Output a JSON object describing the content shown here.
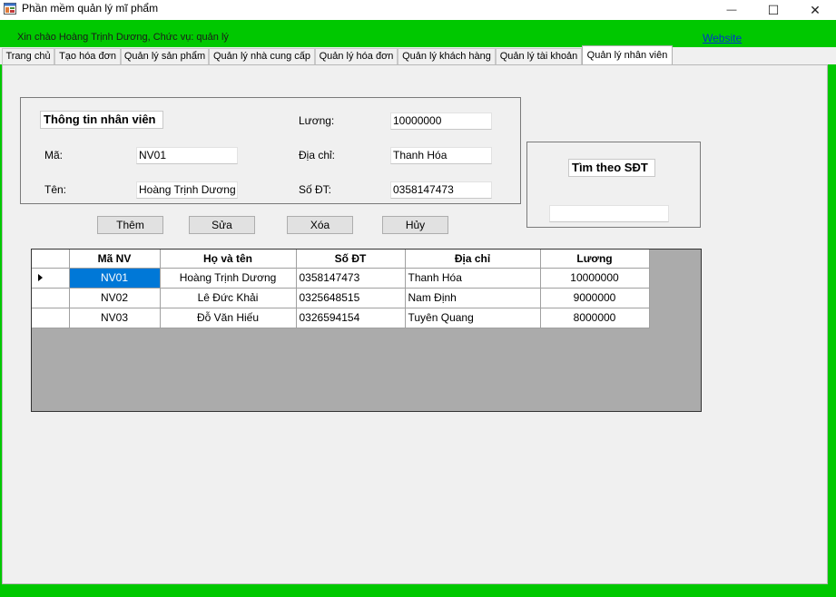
{
  "window": {
    "title": "Phần mềm quản lý mĩ phẩm",
    "minimize_glyph": "—",
    "maximize_glyph": "☐",
    "close_glyph": "✕"
  },
  "header": {
    "greeting": "Xin chào Hoàng Trịnh Dương, Chức vụ: quản lý",
    "website_link": "Website"
  },
  "tabs": [
    {
      "label": "Trang chủ"
    },
    {
      "label": "Tạo hóa đơn"
    },
    {
      "label": "Quản lý sản phẩm"
    },
    {
      "label": "Quản lý nhà cung cấp"
    },
    {
      "label": "Quản lý hóa đơn"
    },
    {
      "label": "Quản lý khách hàng"
    },
    {
      "label": "Quản lý tài khoản"
    },
    {
      "label": "Quản lý nhân viên",
      "active": true
    }
  ],
  "employee_info": {
    "title": "Thông tin nhân viên",
    "ma_label": "Mã:",
    "ma_value": "NV01",
    "ten_label": "Tên:",
    "ten_value": "Hoàng Trịnh Dương",
    "luong_label": "Lương:",
    "luong_value": "10000000",
    "diachi_label": "Địa chỉ:",
    "diachi_value": "Thanh Hóa",
    "sodt_label": "Số ĐT:",
    "sodt_value": "0358147473"
  },
  "search": {
    "title": "Tìm theo SĐT",
    "value": ""
  },
  "buttons": {
    "add": "Thêm",
    "edit": "Sửa",
    "delete": "Xóa",
    "cancel": "Hủy"
  },
  "table": {
    "columns": [
      "Mã NV",
      "Họ và tên",
      "Số ĐT",
      "Địa chỉ",
      "Lương"
    ],
    "rows": [
      {
        "ma": "NV01",
        "ten": "Hoàng Trịnh Dương",
        "sdt": "0358147473",
        "diachi": "Thanh Hóa",
        "luong": "10000000",
        "selected": true
      },
      {
        "ma": "NV02",
        "ten": "Lê Đức Khải",
        "sdt": "0325648515",
        "diachi": "Nam Định",
        "luong": "9000000"
      },
      {
        "ma": "NV03",
        "ten": "Đỗ Văn Hiếu",
        "sdt": "0326594154",
        "diachi": "Tuyên Quang",
        "luong": "8000000"
      }
    ]
  },
  "colors": {
    "header_green": "#00c800",
    "selection_blue": "#0078d7",
    "link_blue": "#0033cc"
  }
}
